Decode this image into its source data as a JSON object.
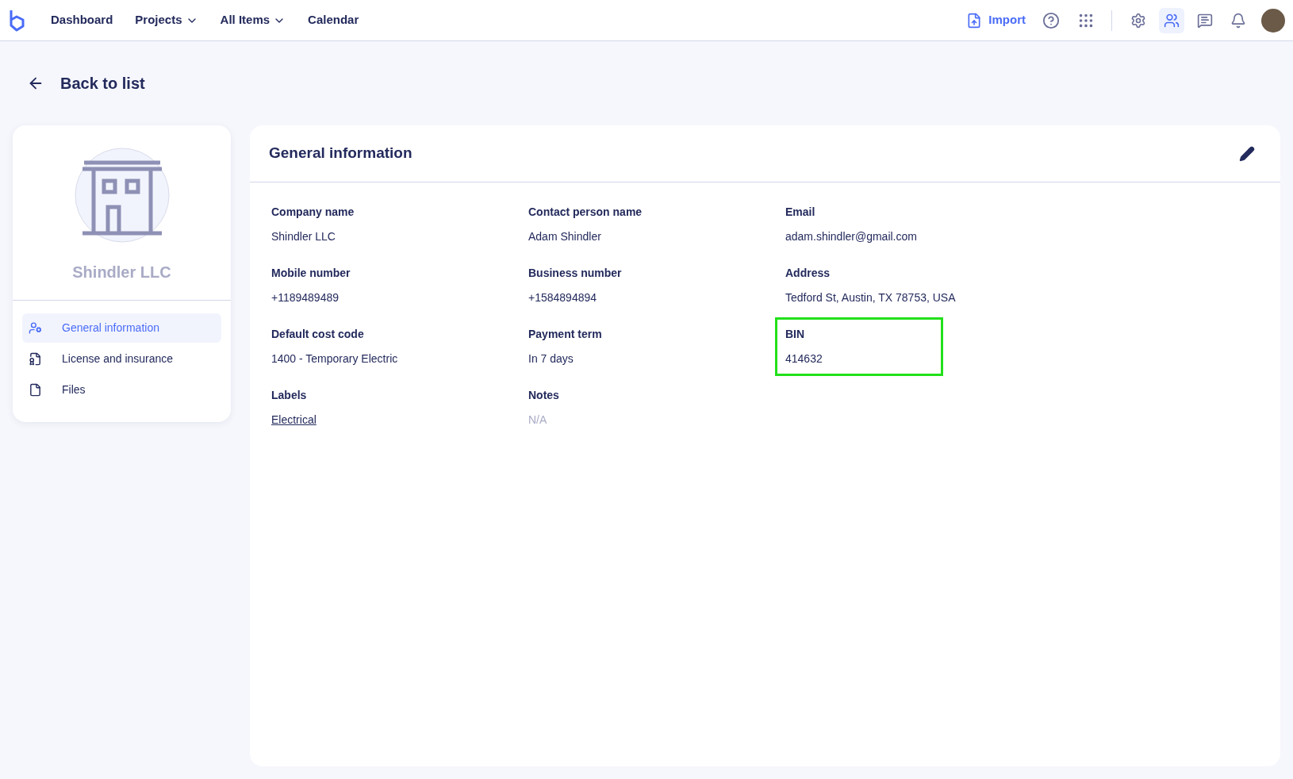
{
  "nav": {
    "items": [
      {
        "label": "Dashboard",
        "dropdown": false
      },
      {
        "label": "Projects",
        "dropdown": true
      },
      {
        "label": "All Items",
        "dropdown": true
      },
      {
        "label": "Calendar",
        "dropdown": false
      }
    ],
    "import_label": "Import",
    "tools": [
      {
        "kind": "settings",
        "selected": false
      },
      {
        "kind": "people",
        "selected": true
      },
      {
        "kind": "messages",
        "selected": false
      },
      {
        "kind": "bell",
        "selected": false
      }
    ]
  },
  "back_label": "Back to list",
  "profile": {
    "name": "Shindler LLC"
  },
  "sidebar": {
    "items": [
      {
        "label": "General information",
        "kind": "general",
        "selected": true
      },
      {
        "label": "License and insurance",
        "kind": "license",
        "selected": false
      },
      {
        "label": "Files",
        "kind": "files",
        "selected": false
      }
    ]
  },
  "panel": {
    "title": "General information",
    "fields": [
      {
        "label": "Company name",
        "value": "Shindler LLC",
        "kind": "text",
        "highlighted": false
      },
      {
        "label": "Contact person name",
        "value": "Adam Shindler",
        "kind": "text",
        "highlighted": false
      },
      {
        "label": "Email",
        "value": "adam.shindler@gmail.com",
        "kind": "text",
        "highlighted": false
      },
      {
        "label": "Mobile number",
        "value": "+1189489489",
        "kind": "text",
        "highlighted": false
      },
      {
        "label": "Business number",
        "value": "+1584894894",
        "kind": "text",
        "highlighted": false
      },
      {
        "label": "Address",
        "value": "Tedford St, Austin, TX 78753, USA",
        "kind": "text",
        "highlighted": false
      },
      {
        "label": "Default cost code",
        "value": "1400 - Temporary Electric",
        "kind": "text",
        "highlighted": false
      },
      {
        "label": "Payment term",
        "value": "In 7 days",
        "kind": "text",
        "highlighted": false
      },
      {
        "label": "BIN",
        "value": "414632",
        "kind": "text",
        "highlighted": true
      },
      {
        "label": "Labels",
        "value": "Electrical",
        "kind": "link",
        "highlighted": false
      },
      {
        "label": "Notes",
        "value": "N/A",
        "kind": "empty",
        "highlighted": false
      }
    ]
  }
}
